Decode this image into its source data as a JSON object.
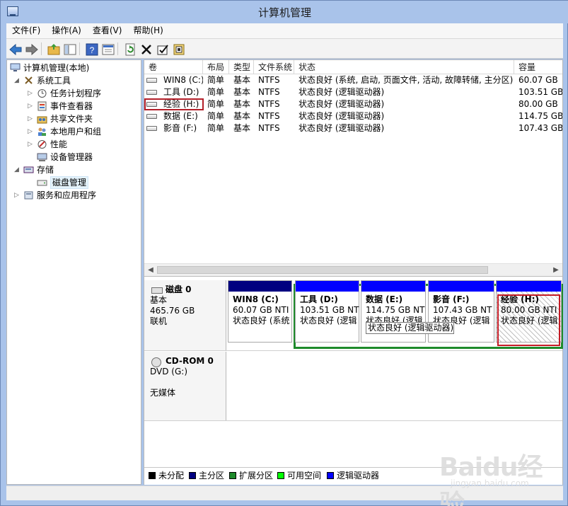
{
  "window": {
    "title": "计算机管理"
  },
  "menu": {
    "items": [
      "文件(F)",
      "操作(A)",
      "查看(V)",
      "帮助(H)"
    ]
  },
  "toolbar": {
    "icons": [
      "back-arrow-icon",
      "forward-arrow-icon",
      "up-folder-icon",
      "show-hide-tree-icon",
      "help-icon",
      "properties-icon",
      "refresh-icon",
      "delete-icon",
      "check-icon",
      "export-icon"
    ]
  },
  "tree": {
    "root": "计算机管理(本地)",
    "system_tools": "系统工具",
    "task_scheduler": "任务计划程序",
    "event_viewer": "事件查看器",
    "shared_folders": "共享文件夹",
    "local_users": "本地用户和组",
    "performance": "性能",
    "device_manager": "设备管理器",
    "storage": "存储",
    "disk_management": "磁盘管理",
    "services": "服务和应用程序"
  },
  "volumes": {
    "headers": [
      "卷",
      "布局",
      "类型",
      "文件系统",
      "状态",
      "容量"
    ],
    "rows": [
      [
        "WIN8 (C:)",
        "简单",
        "基本",
        "NTFS",
        "状态良好 (系统, 启动, 页面文件, 活动, 故障转储, 主分区)",
        "60.07 GB"
      ],
      [
        "工具 (D:)",
        "简单",
        "基本",
        "NTFS",
        "状态良好 (逻辑驱动器)",
        "103.51 GB"
      ],
      [
        "经验 (H:)",
        "简单",
        "基本",
        "NTFS",
        "状态良好 (逻辑驱动器)",
        "80.00 GB"
      ],
      [
        "数据 (E:)",
        "简单",
        "基本",
        "NTFS",
        "状态良好 (逻辑驱动器)",
        "114.75 GB"
      ],
      [
        "影音 (F:)",
        "简单",
        "基本",
        "NTFS",
        "状态良好 (逻辑驱动器)",
        "107.43 GB"
      ]
    ]
  },
  "disks": {
    "disk0": {
      "name": "磁盘 0",
      "type": "基本",
      "size": "465.76 GB",
      "status": "联机"
    },
    "cdrom": {
      "name": "CD-ROM 0",
      "drive": "DVD (G:)",
      "media": "无媒体"
    },
    "partitions": [
      {
        "title": "WIN8 (C:)",
        "size": "60.07 GB NTI",
        "status": "状态良好 (系统"
      },
      {
        "title": "工具 (D:)",
        "size": "103.51 GB NT",
        "status": "状态良好 (逻辑"
      },
      {
        "title": "数据 (E:)",
        "size": "114.75 GB NT",
        "status": "状态良好 (逻辑"
      },
      {
        "title": "影音 (F:)",
        "size": "107.43 GB NT",
        "status": "状态良好 (逻辑"
      },
      {
        "title": "经验 (H:)",
        "size": "80.00 GB NTI",
        "status": "状态良好 (逻辑"
      }
    ],
    "tooltip": "状态良好 (逻辑驱动器)"
  },
  "legend": {
    "items": [
      "未分配",
      "主分区",
      "扩展分区",
      "可用空间",
      "逻辑驱动器"
    ],
    "colors": [
      "#000000",
      "#000080",
      "#1e8a2b",
      "#00ff00",
      "#0000ff"
    ]
  },
  "colors": {
    "primary": "#000080",
    "logical": "#0000ff",
    "extended": "#1e8a2b",
    "highlight": "#c31b25"
  },
  "watermark": {
    "brand": "Baidu经验",
    "url": "jingyan.baidu.com"
  }
}
